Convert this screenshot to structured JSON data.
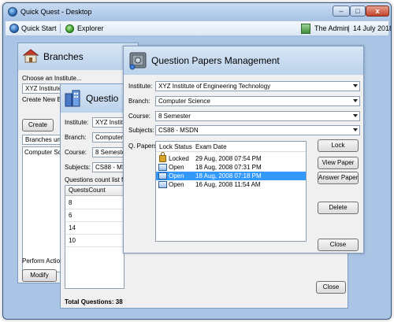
{
  "window": {
    "title": "Quick Quest - Desktop",
    "minimize": "–",
    "maximize": "□",
    "close": "x"
  },
  "menubar": {
    "quick_start": "Quick Start",
    "explorer": "Explorer",
    "user": "The Admin",
    "date": "14 July 2018",
    "separator": "|"
  },
  "branches": {
    "title": "Branches",
    "choose_institute": "Choose an Institute...",
    "institute_value": "XYZ Institute o",
    "create_new": "Create New Bra",
    "create_button": "Create",
    "branches_under": "Branches und",
    "branch_item": "Computer Scie",
    "perform_action": "Perform Action...",
    "modify_button": "Modify"
  },
  "questions": {
    "title": "Questio",
    "institute_label": "Institute:",
    "institute_value": "XYZ Institute",
    "branch_label": "Branch:",
    "branch_value": "Computer Sc",
    "course_label": "Course:",
    "course_value": "8 Semester",
    "subjects_label": "Subjects:",
    "subjects_value": "CS88 - MSDN",
    "count_label": "Questions count list for s",
    "column": "QuestsCount",
    "counts": [
      "8",
      "6",
      "14",
      "10"
    ],
    "close_button": "Close",
    "total": "Total Questions: 38"
  },
  "qp": {
    "title": "Question Papers Management",
    "institute_label": "Institute:",
    "institute_value": "XYZ Institute of Engineering Technology",
    "branch_label": "Branch:",
    "branch_value": "Computer Science",
    "course_label": "Course:",
    "course_value": "8 Semester",
    "subjects_label": "Subjects:",
    "subjects_value": "CS88 - MSDN",
    "papers_label": "Q. Papers",
    "col_lock": "Lock Status",
    "col_date": "Exam Date",
    "papers": [
      {
        "status": "Locked",
        "date": "29 Aug, 2008 07:54 PM",
        "icon": "lock-icon"
      },
      {
        "status": "Open",
        "date": "18 Aug, 2008 07:31 PM",
        "icon": "folder-icon"
      },
      {
        "status": "Open",
        "date": "18 Aug, 2008 07:18 PM",
        "icon": "folder-icon"
      },
      {
        "status": "Open",
        "date": "16 Aug, 2008 11:54 AM",
        "icon": "folder-icon"
      }
    ],
    "selected_index": 2,
    "lock_button": "Lock",
    "view_button": "View Paper",
    "answer_button": "Answer Paper",
    "delete_button": "Delete",
    "close_button": "Close"
  }
}
